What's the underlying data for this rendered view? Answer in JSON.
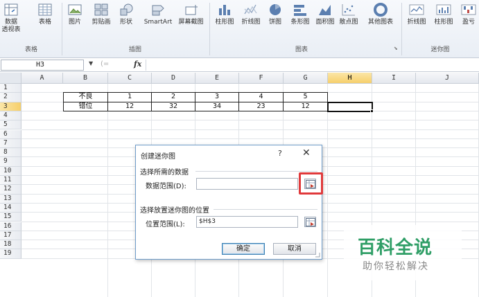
{
  "ribbon": {
    "buttons": [
      {
        "id": "pivottable",
        "label": "数据",
        "label2": "透视表"
      },
      {
        "id": "table",
        "label": "表格"
      },
      {
        "id": "picture",
        "label": "图片"
      },
      {
        "id": "clipart",
        "label": "剪贴画"
      },
      {
        "id": "shapes",
        "label": "形状"
      },
      {
        "id": "smartart",
        "label": "SmartArt"
      },
      {
        "id": "screenshot",
        "label": "屏幕截图"
      },
      {
        "id": "col-chart",
        "label": "柱形图"
      },
      {
        "id": "line-chart",
        "label": "折线图"
      },
      {
        "id": "pie-chart",
        "label": "饼图"
      },
      {
        "id": "bar-chart",
        "label": "条形图"
      },
      {
        "id": "area-chart",
        "label": "面积图"
      },
      {
        "id": "scatter-chart",
        "label": "散点图"
      },
      {
        "id": "other-chart",
        "label": "其他图表"
      },
      {
        "id": "spark-line",
        "label": "折线图"
      },
      {
        "id": "spark-col",
        "label": "柱形图"
      },
      {
        "id": "spark-winloss",
        "label": "盈亏"
      }
    ],
    "groups": {
      "tables": "表格",
      "illustrations": "插图",
      "charts": "图表",
      "sparklines": "迷你图"
    }
  },
  "formula_bar": {
    "name_box": "H3",
    "fx": "fx",
    "value": ""
  },
  "grid": {
    "columns": [
      "A",
      "B",
      "C",
      "D",
      "E",
      "F",
      "G",
      "H",
      "I",
      "J"
    ],
    "selected_column": "H",
    "rows": [
      "1",
      "2",
      "3",
      "4",
      "5",
      "6",
      "7",
      "8",
      "9",
      "10",
      "11",
      "12",
      "13",
      "14",
      "15",
      "16",
      "17",
      "18",
      "19"
    ],
    "selected_row": "3",
    "table": [
      [
        "不良",
        "1",
        "2",
        "3",
        "4",
        "5"
      ],
      [
        "错位",
        "12",
        "32",
        "34",
        "23",
        "12"
      ]
    ]
  },
  "dialog": {
    "title": "创建迷你图",
    "help": "?",
    "close": "✕",
    "section_data": "选择所需的数据",
    "data_range_label": "数据范围(D):",
    "data_range_value": "",
    "section_location": "选择放置迷你图的位置",
    "location_range_label": "位置范围(L):",
    "location_range_value": "$H$3",
    "ok": "确定",
    "cancel": "取消"
  },
  "watermark": {
    "title": "百科全说",
    "subtitle": "助你轻松解决"
  },
  "colors": {
    "accent_green": "#2f9e66",
    "highlight_red": "#e0393b",
    "selected_header": "#f6cf6b"
  }
}
